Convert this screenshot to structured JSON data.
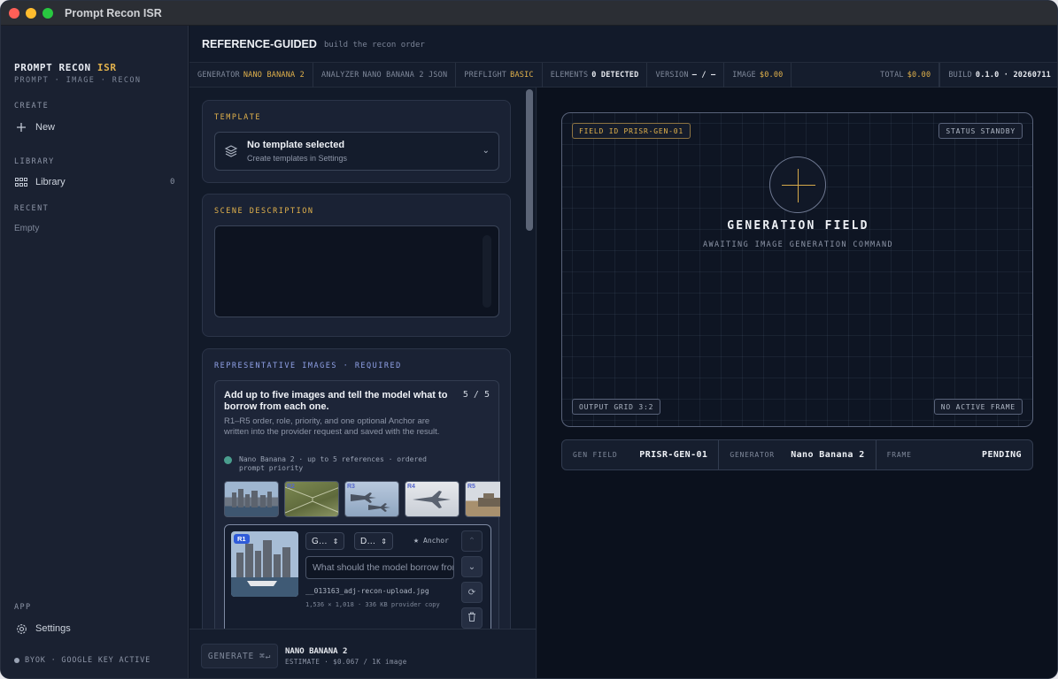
{
  "window": {
    "title": "Prompt Recon ISR"
  },
  "brand": {
    "name": "PROMPT RECON",
    "accent": "ISR",
    "subtitle": "PROMPT · IMAGE · RECON"
  },
  "sidebar": {
    "create_label": "CREATE",
    "new_label": "New",
    "library_section": "LIBRARY",
    "library_label": "Library",
    "library_count": "0",
    "recent_section": "RECENT",
    "recent_empty": "Empty",
    "app_section": "APP",
    "settings_label": "Settings",
    "byok": "BYOK · GOOGLE KEY ACTIVE"
  },
  "header": {
    "title": "REFERENCE-GUIDED",
    "subtitle": "build the recon order"
  },
  "statusbar": {
    "generator_k": "GENERATOR",
    "generator_v": "NANO BANANA 2",
    "analyzer_k": "ANALYZER",
    "analyzer_v": "NANO BANANA 2 JSON",
    "preflight_k": "PREFLIGHT",
    "preflight_v": "BASIC",
    "elements_k": "ELEMENTS",
    "elements_v": "0 DETECTED",
    "version_k": "VERSION",
    "version_v": "– / –",
    "image_k": "IMAGE",
    "image_v": "$0.00",
    "total_k": "TOTAL",
    "total_v": "$0.00",
    "build_k": "BUILD",
    "build_v": "0.1.0 · 20260711"
  },
  "template": {
    "label": "TEMPLATE",
    "selected": "No template selected",
    "hint": "Create templates in Settings"
  },
  "scene": {
    "label": "SCENE DESCRIPTION",
    "value": ""
  },
  "references": {
    "label": "REPRESENTATIVE IMAGES · REQUIRED",
    "intro": "Add up to five images and tell the model what to borrow from each one.",
    "count": "5 / 5",
    "description": "R1–R5 order, role, priority, and one optional Anchor are written into the provider request and saved with the result.",
    "note": "Nano Banana 2 · up to 5 references · ordered prompt priority",
    "thumb_labels": [
      "R1",
      "R2",
      "R3",
      "R4",
      "R5"
    ],
    "card": {
      "badge": "R1",
      "role": "G…",
      "priority": "D…",
      "anchor_label": "Anchor",
      "borrow_placeholder": "What should the model borrow from this image?",
      "filename": "__013163_adj-recon-upload.jpg",
      "meta": "1,536 × 1,018 · 336 KB provider copy"
    }
  },
  "generate": {
    "button": "GENERATE",
    "shortcut": "⌘↵",
    "model": "NANO BANANA 2",
    "estimate": "ESTIMATE · $0.067 / 1K image"
  },
  "field": {
    "id_chip": "FIELD ID PRISR-GEN-01",
    "status_chip": "STATUS STANDBY",
    "title": "GENERATION FIELD",
    "subtitle": "AWAITING IMAGE GENERATION COMMAND",
    "grid_chip": "OUTPUT GRID 3:2",
    "frame_chip": "NO ACTIVE FRAME"
  },
  "infobar": {
    "gen_field_k": "GEN FIELD",
    "gen_field_v": "PRISR-GEN-01",
    "generator_k": "GENERATOR",
    "generator_v": "Nano Banana 2",
    "frame_k": "FRAME",
    "frame_v": "PENDING"
  },
  "colors": {
    "accent": "#e2b24c",
    "label_blue": "#8fa0e6",
    "badge": "#2f5bd9"
  }
}
